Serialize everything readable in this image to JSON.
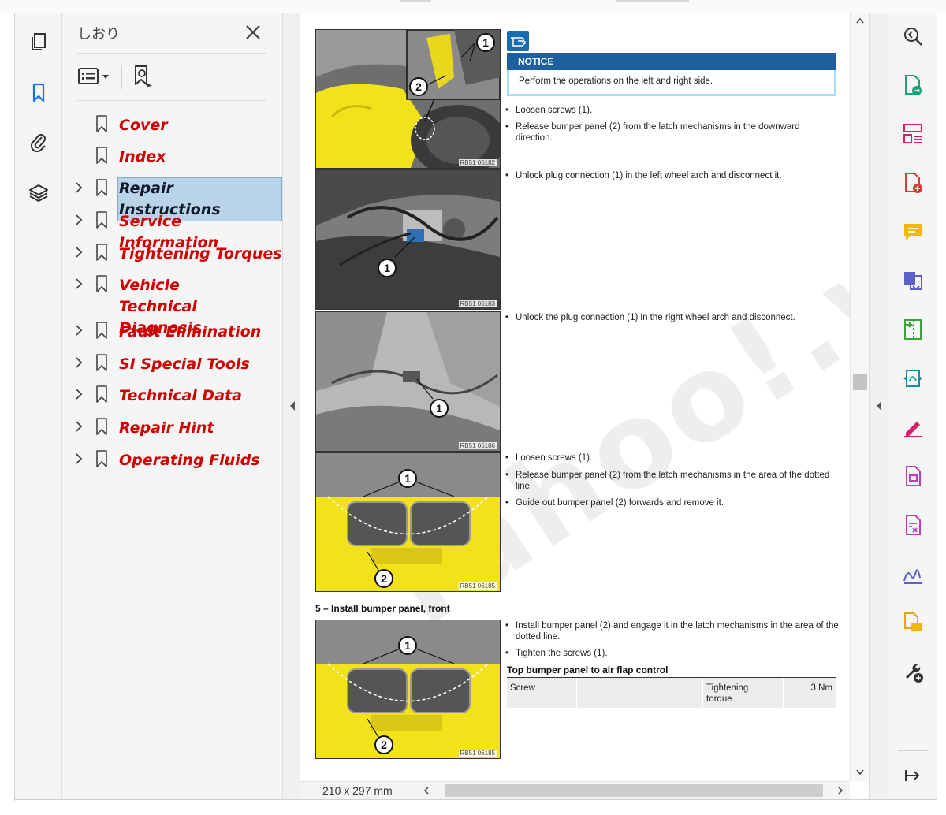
{
  "bookmarks_panel": {
    "title": "しおり",
    "items": [
      {
        "label": "Cover",
        "expandable": false,
        "selected": false
      },
      {
        "label": "Index",
        "expandable": false,
        "selected": false
      },
      {
        "label": "Repair Instructions",
        "expandable": true,
        "selected": true
      },
      {
        "label": "Service Information",
        "expandable": true,
        "selected": false
      },
      {
        "label": "Tightening Torques",
        "expandable": true,
        "selected": false
      },
      {
        "label": "Vehicle Technical Diagnosis",
        "expandable": true,
        "selected": false
      },
      {
        "label": "Fault Elimination",
        "expandable": true,
        "selected": false
      },
      {
        "label": "SI Special Tools",
        "expandable": true,
        "selected": false
      },
      {
        "label": "Technical Data",
        "expandable": true,
        "selected": false
      },
      {
        "label": "Repair Hint",
        "expandable": true,
        "selected": false
      },
      {
        "label": "Operating Fluids",
        "expandable": true,
        "selected": false
      }
    ]
  },
  "left_rail": {
    "icons": [
      "pages-thumbnail-icon",
      "bookmark-icon",
      "attachment-icon",
      "layers-icon"
    ]
  },
  "document": {
    "notice": {
      "heading": "NOTICE",
      "text": "Perform the operations on the left and right side."
    },
    "figures": [
      {
        "code": "RB51 06182",
        "callouts": [
          "1",
          "2"
        ]
      },
      {
        "code": "RB51 06183",
        "callouts": [
          "1"
        ]
      },
      {
        "code": "RB51 06186",
        "callouts": [
          "1"
        ]
      },
      {
        "code": "RB51 06185",
        "callouts": [
          "1",
          "2"
        ]
      },
      {
        "code": "RB51 06185",
        "callouts": [
          "1",
          "2"
        ]
      }
    ],
    "steps": {
      "s1": "Loosen screws (1).",
      "s2": "Release bumper panel (2) from the latch mechanisms in the downward direction.",
      "s3": "Unlock plug connection (1) in the left wheel arch and disconnect it.",
      "s4": "Unlock the plug connection (1) in the right wheel arch and disconnect.",
      "s5": "Loosen screws (1).",
      "s6": "Release bumper panel (2) from the latch mechanisms in the area of the dotted line.",
      "s7": "Guide out bumper panel (2) forwards and remove it.",
      "s8": "Install bumper panel (2) and engage it in the latch mechanisms in the area of the dotted line.",
      "s9": "Tighten the screws (1)."
    },
    "section_heading": "5 – Install bumper panel, front",
    "torque_table": {
      "title": "Top bumper panel to air flap control",
      "row": {
        "part": "Screw",
        "label": "Tightening torque",
        "value": "3 Nm"
      }
    },
    "watermark": "Yahoo!.wnqwz"
  },
  "status": {
    "page_size": "210 x 297 mm"
  },
  "right_tools": [
    "zoom-icon",
    "export-pdf-icon",
    "organize-pages-icon",
    "create-pdf-icon",
    "comment-icon",
    "combine-files-icon",
    "compress-pdf-icon",
    "convert-pdf-icon",
    "fill-sign-icon",
    "edit-pdf-icon",
    "redact-icon",
    "signature-icon",
    "send-for-comments-icon",
    "more-tools-icon"
  ],
  "colors": {
    "bookmark_text": "#d00000",
    "selected_bg": "#b9d3e9",
    "notice_bar": "#1e5f9f",
    "accent_yellow": "#f2e21a"
  }
}
